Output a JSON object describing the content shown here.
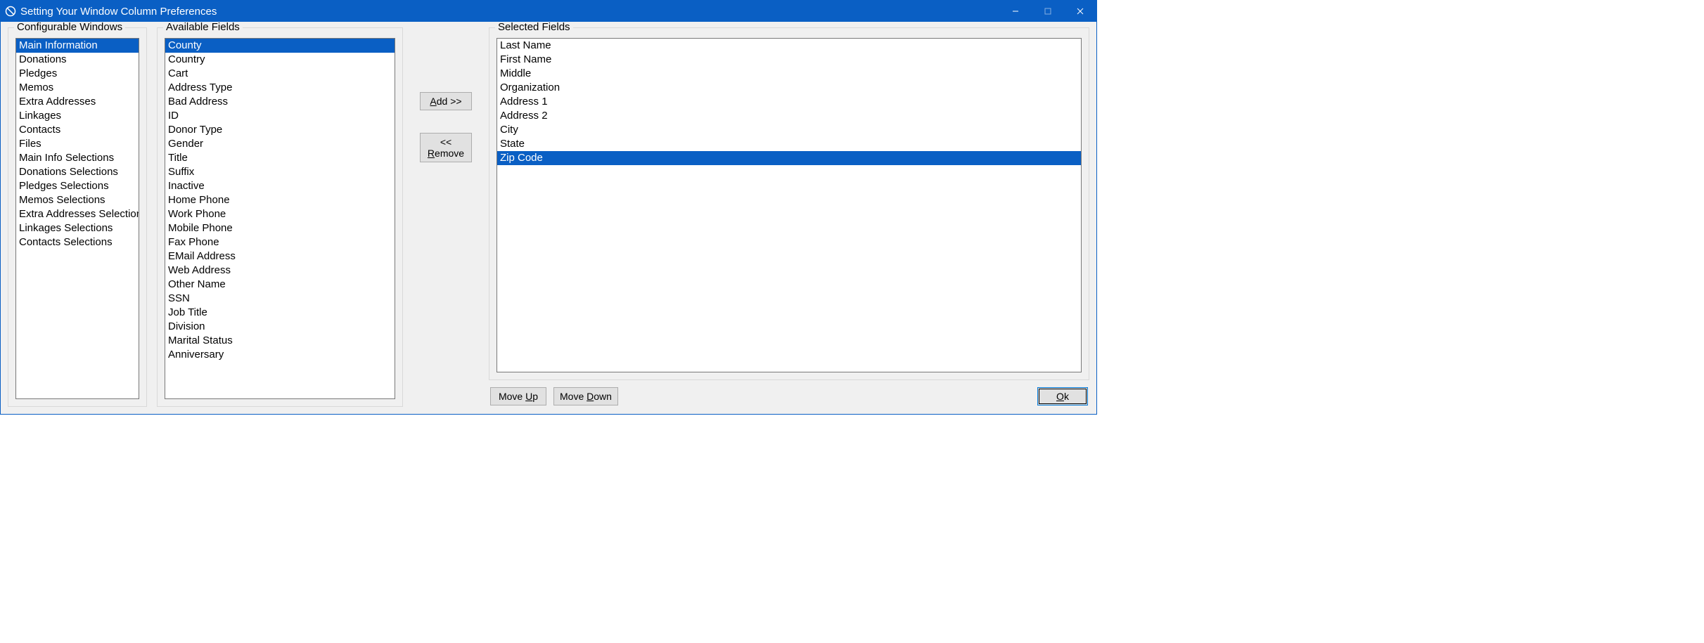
{
  "window": {
    "title": "Setting Your Window Column Preferences"
  },
  "groups": {
    "configurable_label": "Configurable Windows",
    "available_label": "Available Fields",
    "selected_label": "Selected Fields"
  },
  "buttons": {
    "add": "Add >>",
    "add_underline_char": "A",
    "add_rest": "dd >>",
    "remove": "<< Remove",
    "remove_prefix": "<< ",
    "remove_ul": "R",
    "remove_rest": "emove",
    "move_up_prefix": "Move ",
    "move_up_ul": "U",
    "move_up_rest": "p",
    "move_down_prefix": "Move ",
    "move_down_ul": "D",
    "move_down_rest": "own",
    "ok_ul": "O",
    "ok_rest": "k"
  },
  "configurable_windows": {
    "selected_index": 0,
    "items": [
      "Main Information",
      "Donations",
      "Pledges",
      "Memos",
      "Extra Addresses",
      "Linkages",
      "Contacts",
      "Files",
      "Main Info Selections",
      "Donations Selections",
      "Pledges Selections",
      "Memos Selections",
      "Extra Addresses Selections",
      "Linkages Selections",
      "Contacts Selections"
    ]
  },
  "available_fields": {
    "selected_index": 0,
    "items": [
      "County",
      "Country",
      "Cart",
      "Address Type",
      "Bad Address",
      "ID",
      "Donor Type",
      "Gender",
      "Title",
      "Suffix",
      "Inactive",
      "Home Phone",
      "Work Phone",
      "Mobile Phone",
      "Fax Phone",
      "EMail Address",
      "Web Address",
      "Other Name",
      "SSN",
      "Job Title",
      "Division",
      "Marital Status",
      "Anniversary"
    ]
  },
  "selected_fields": {
    "selected_index": 8,
    "items": [
      "Last Name",
      "First Name",
      "Middle",
      "Organization",
      "Address 1",
      "Address 2",
      "City",
      "State",
      "Zip Code"
    ]
  }
}
